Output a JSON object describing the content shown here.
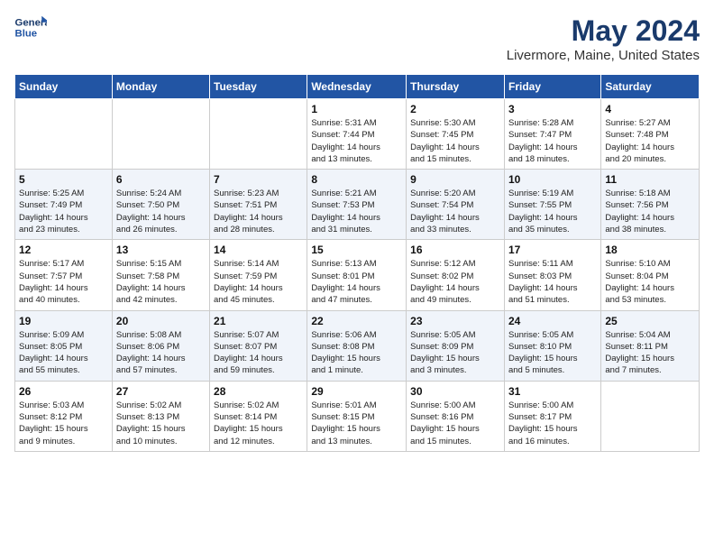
{
  "header": {
    "title": "May 2024",
    "subtitle": "Livermore, Maine, United States",
    "logo_line1": "General",
    "logo_line2": "Blue"
  },
  "weekdays": [
    "Sunday",
    "Monday",
    "Tuesday",
    "Wednesday",
    "Thursday",
    "Friday",
    "Saturday"
  ],
  "weeks": [
    [
      {
        "day": "",
        "info": ""
      },
      {
        "day": "",
        "info": ""
      },
      {
        "day": "",
        "info": ""
      },
      {
        "day": "1",
        "info": "Sunrise: 5:31 AM\nSunset: 7:44 PM\nDaylight: 14 hours\nand 13 minutes."
      },
      {
        "day": "2",
        "info": "Sunrise: 5:30 AM\nSunset: 7:45 PM\nDaylight: 14 hours\nand 15 minutes."
      },
      {
        "day": "3",
        "info": "Sunrise: 5:28 AM\nSunset: 7:47 PM\nDaylight: 14 hours\nand 18 minutes."
      },
      {
        "day": "4",
        "info": "Sunrise: 5:27 AM\nSunset: 7:48 PM\nDaylight: 14 hours\nand 20 minutes."
      }
    ],
    [
      {
        "day": "5",
        "info": "Sunrise: 5:25 AM\nSunset: 7:49 PM\nDaylight: 14 hours\nand 23 minutes."
      },
      {
        "day": "6",
        "info": "Sunrise: 5:24 AM\nSunset: 7:50 PM\nDaylight: 14 hours\nand 26 minutes."
      },
      {
        "day": "7",
        "info": "Sunrise: 5:23 AM\nSunset: 7:51 PM\nDaylight: 14 hours\nand 28 minutes."
      },
      {
        "day": "8",
        "info": "Sunrise: 5:21 AM\nSunset: 7:53 PM\nDaylight: 14 hours\nand 31 minutes."
      },
      {
        "day": "9",
        "info": "Sunrise: 5:20 AM\nSunset: 7:54 PM\nDaylight: 14 hours\nand 33 minutes."
      },
      {
        "day": "10",
        "info": "Sunrise: 5:19 AM\nSunset: 7:55 PM\nDaylight: 14 hours\nand 35 minutes."
      },
      {
        "day": "11",
        "info": "Sunrise: 5:18 AM\nSunset: 7:56 PM\nDaylight: 14 hours\nand 38 minutes."
      }
    ],
    [
      {
        "day": "12",
        "info": "Sunrise: 5:17 AM\nSunset: 7:57 PM\nDaylight: 14 hours\nand 40 minutes."
      },
      {
        "day": "13",
        "info": "Sunrise: 5:15 AM\nSunset: 7:58 PM\nDaylight: 14 hours\nand 42 minutes."
      },
      {
        "day": "14",
        "info": "Sunrise: 5:14 AM\nSunset: 7:59 PM\nDaylight: 14 hours\nand 45 minutes."
      },
      {
        "day": "15",
        "info": "Sunrise: 5:13 AM\nSunset: 8:01 PM\nDaylight: 14 hours\nand 47 minutes."
      },
      {
        "day": "16",
        "info": "Sunrise: 5:12 AM\nSunset: 8:02 PM\nDaylight: 14 hours\nand 49 minutes."
      },
      {
        "day": "17",
        "info": "Sunrise: 5:11 AM\nSunset: 8:03 PM\nDaylight: 14 hours\nand 51 minutes."
      },
      {
        "day": "18",
        "info": "Sunrise: 5:10 AM\nSunset: 8:04 PM\nDaylight: 14 hours\nand 53 minutes."
      }
    ],
    [
      {
        "day": "19",
        "info": "Sunrise: 5:09 AM\nSunset: 8:05 PM\nDaylight: 14 hours\nand 55 minutes."
      },
      {
        "day": "20",
        "info": "Sunrise: 5:08 AM\nSunset: 8:06 PM\nDaylight: 14 hours\nand 57 minutes."
      },
      {
        "day": "21",
        "info": "Sunrise: 5:07 AM\nSunset: 8:07 PM\nDaylight: 14 hours\nand 59 minutes."
      },
      {
        "day": "22",
        "info": "Sunrise: 5:06 AM\nSunset: 8:08 PM\nDaylight: 15 hours\nand 1 minute."
      },
      {
        "day": "23",
        "info": "Sunrise: 5:05 AM\nSunset: 8:09 PM\nDaylight: 15 hours\nand 3 minutes."
      },
      {
        "day": "24",
        "info": "Sunrise: 5:05 AM\nSunset: 8:10 PM\nDaylight: 15 hours\nand 5 minutes."
      },
      {
        "day": "25",
        "info": "Sunrise: 5:04 AM\nSunset: 8:11 PM\nDaylight: 15 hours\nand 7 minutes."
      }
    ],
    [
      {
        "day": "26",
        "info": "Sunrise: 5:03 AM\nSunset: 8:12 PM\nDaylight: 15 hours\nand 9 minutes."
      },
      {
        "day": "27",
        "info": "Sunrise: 5:02 AM\nSunset: 8:13 PM\nDaylight: 15 hours\nand 10 minutes."
      },
      {
        "day": "28",
        "info": "Sunrise: 5:02 AM\nSunset: 8:14 PM\nDaylight: 15 hours\nand 12 minutes."
      },
      {
        "day": "29",
        "info": "Sunrise: 5:01 AM\nSunset: 8:15 PM\nDaylight: 15 hours\nand 13 minutes."
      },
      {
        "day": "30",
        "info": "Sunrise: 5:00 AM\nSunset: 8:16 PM\nDaylight: 15 hours\nand 15 minutes."
      },
      {
        "day": "31",
        "info": "Sunrise: 5:00 AM\nSunset: 8:17 PM\nDaylight: 15 hours\nand 16 minutes."
      },
      {
        "day": "",
        "info": ""
      }
    ]
  ]
}
